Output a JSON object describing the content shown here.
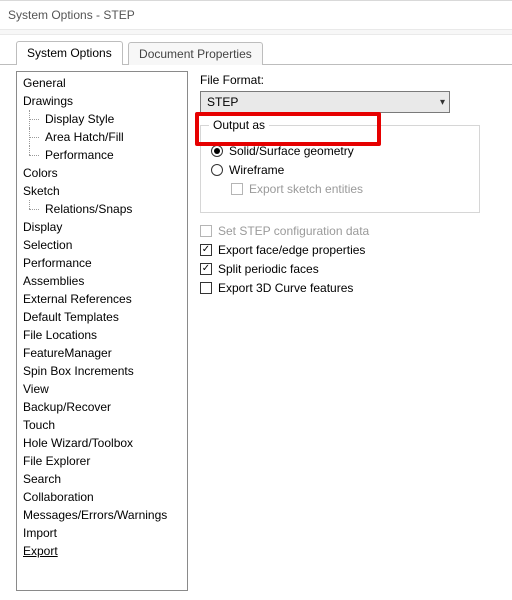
{
  "window": {
    "title": "System Options - STEP"
  },
  "tabs": {
    "system_options": "System Options",
    "document_properties": "Document Properties"
  },
  "tree": {
    "items": [
      {
        "label": "General"
      },
      {
        "label": "Drawings"
      },
      {
        "label": "Display Style",
        "child": true
      },
      {
        "label": "Area Hatch/Fill",
        "child": true
      },
      {
        "label": "Performance",
        "child": true,
        "last": true
      },
      {
        "label": "Colors"
      },
      {
        "label": "Sketch"
      },
      {
        "label": "Relations/Snaps",
        "child": true,
        "last": true
      },
      {
        "label": "Display"
      },
      {
        "label": "Selection"
      },
      {
        "label": "Performance"
      },
      {
        "label": "Assemblies"
      },
      {
        "label": "External References"
      },
      {
        "label": "Default Templates"
      },
      {
        "label": "File Locations"
      },
      {
        "label": "FeatureManager"
      },
      {
        "label": "Spin Box Increments"
      },
      {
        "label": "View"
      },
      {
        "label": "Backup/Recover"
      },
      {
        "label": "Touch"
      },
      {
        "label": "Hole Wizard/Toolbox"
      },
      {
        "label": "File Explorer"
      },
      {
        "label": "Search"
      },
      {
        "label": "Collaboration"
      },
      {
        "label": "Messages/Errors/Warnings"
      },
      {
        "label": "Import"
      },
      {
        "label": "Export",
        "selected": true
      }
    ]
  },
  "right": {
    "file_format_label": "File Format:",
    "file_format_value": "STEP",
    "output_group": {
      "legend": "Output as",
      "solid_surface": "Solid/Surface geometry",
      "wireframe": "Wireframe",
      "export_sketch": "Export sketch entities"
    },
    "set_config": "Set STEP configuration data",
    "export_face_edge": "Export face/edge properties",
    "split_periodic": "Split periodic faces",
    "export_3d_curve": "Export 3D Curve features"
  }
}
